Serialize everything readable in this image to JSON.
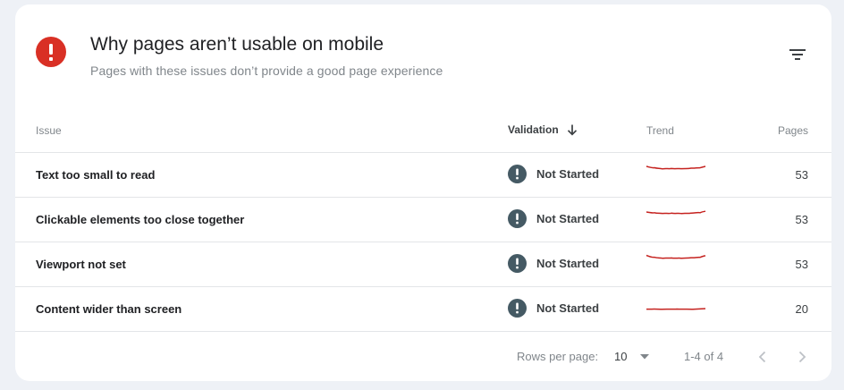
{
  "card": {
    "title": "Why pages aren’t usable on mobile",
    "subtitle": "Pages with these issues don’t provide a good page experience",
    "alert_icon": "error-icon",
    "filter_icon": "filter-list-icon"
  },
  "table": {
    "headers": {
      "issue": "Issue",
      "validation": "Validation",
      "trend": "Trend",
      "pages": "Pages"
    },
    "rows": [
      {
        "issue": "Text too small to read",
        "status": "Not Started",
        "pages": "53"
      },
      {
        "issue": "Clickable elements too close together",
        "status": "Not Started",
        "pages": "53"
      },
      {
        "issue": "Viewport not set",
        "status": "Not Started",
        "pages": "53"
      },
      {
        "issue": "Content wider than screen",
        "status": "Not Started",
        "pages": "20"
      }
    ]
  },
  "pager": {
    "rows_per_page_label": "Rows per page:",
    "rows_per_page_value": "10",
    "range": "1-4 of 4"
  },
  "colors": {
    "error": "#d93025",
    "status_icon": "#455a64",
    "trend_line": "#c5221f",
    "background": "#eef1f6"
  }
}
